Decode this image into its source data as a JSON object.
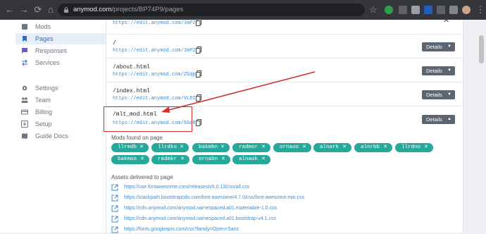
{
  "browser": {
    "url_host": "anymod.com",
    "url_path": "/projects/BP74P9/pages"
  },
  "sidebar": {
    "items": [
      {
        "label": "Mods",
        "icon": "cube-icon",
        "active": false
      },
      {
        "label": "Pages",
        "icon": "bookmark-icon",
        "active": true
      },
      {
        "label": "Responses",
        "icon": "chat-icon",
        "active": false
      },
      {
        "label": "Services",
        "icon": "swap-icon",
        "active": false
      },
      {
        "label": "Settings",
        "icon": "gear-icon",
        "active": false
      },
      {
        "label": "Team",
        "icon": "people-icon",
        "active": false
      },
      {
        "label": "Billing",
        "icon": "card-icon",
        "active": false
      },
      {
        "label": "Setup",
        "icon": "download-icon",
        "active": false
      },
      {
        "label": "Guide Docs",
        "icon": "map-icon",
        "active": false
      }
    ]
  },
  "pages": [
    {
      "title": "",
      "url": "https://edit.anymod.com/1mP2J",
      "details": ""
    },
    {
      "title": "/",
      "url": "https://edit.anymod.com/1mP2J",
      "details": "Details"
    },
    {
      "title": "/about.html",
      "url": "https://edit.anymod.com/ZGqpv",
      "details": "Details"
    },
    {
      "title": "/index.html",
      "url": "https://edit.anymod.com/VLDIP",
      "details": "Details"
    },
    {
      "title": "/mlt_mod.html",
      "url": "https://edit.anymod.com/6Gq8m",
      "details": "Details"
    }
  ],
  "mods_found_label": "Mods found on page",
  "mods": [
    "llrmdb",
    "llrdko",
    "bakmbn",
    "radmor",
    "ornaoo",
    "alnark",
    "alnrbb",
    "llrdno",
    "bakmoo",
    "radmkr",
    "ornabn",
    "alnaok"
  ],
  "assets_label": "Assets delivered to page",
  "assets": [
    "https://use.fontawesome.com/releases/v5.0.13/css/all.css",
    "https://stackpath.bootstrapcdn.com/font-awesome/4.7.0/css/font-awesome.min.css",
    "https://cdn.anymod.com/anymod.namespaced.a01.materialize-1.0.css",
    "https://cdn.anymod.com/anymod.namespaced.a01.bootstrap-v4.1.css",
    "https://fonts.googleapis.com/css?family=Open+Sans"
  ],
  "colors": {
    "accent_teal": "#26a89a",
    "details_button": "#5d6570",
    "link_blue": "#3e8bd1",
    "annotation_red": "#d32f2f"
  }
}
